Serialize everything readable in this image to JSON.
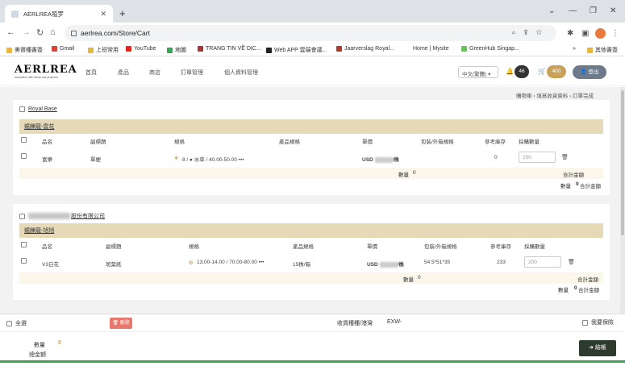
{
  "browser": {
    "tab_title": "AERLREA殖罗",
    "url": "aerlrea.com/Store/Cart",
    "bookmarks": [
      "美督種書簽",
      "Gmail",
      "上班常用",
      "YouTube",
      "地圖",
      "TRANG TIN VỀ DỊC...",
      "Web APP 雲端會議...",
      "Jaarverslag Royal...",
      "Home | Mysite",
      "GreenHub Singap...",
      "其他書簽"
    ]
  },
  "site": {
    "logo": "AERLREA",
    "logo_sub": "Innovation with ideas and products",
    "nav": [
      "首頁",
      "產品",
      "商店",
      "訂單管理",
      "個人資料管理"
    ],
    "language": "中文(繁體)",
    "notifications": "46",
    "cart_count": "400",
    "logout": "登出"
  },
  "breadcrumb": "購物車  ›  填寫收貨資料  ›  訂單完成",
  "cards": [
    {
      "supplier": "Royal Base",
      "group": "鋸鑠龍-雲花",
      "headers": [
        "品名",
        "副標題",
        "規格",
        "產品規格",
        "單價",
        "包裝/外箱規格",
        "參考庫存",
        "採購數量"
      ],
      "row": {
        "name": "富樂",
        "subtitle": "單梗",
        "spec": "8 / ● 水草 / 40.00-50.00 •••",
        "product_spec": "",
        "price_prefix": "USD",
        "price_suffix": "/株",
        "packing": "",
        "stock": "0",
        "qty_placeholder": "200"
      },
      "qty_label": "數量",
      "qty_value": "0",
      "subtotal_label": "合計金額",
      "subtotal_qty_label": "數量",
      "subtotal_qty_value": "0",
      "subtotal_total_label": "合計金額"
    },
    {
      "supplier": "股份有限公司",
      "group": "鋸鑠龍-旭旭",
      "headers": [
        "品名",
        "副標題",
        "規格",
        "產品規格",
        "單價",
        "包裝/外箱規格",
        "參考庫存",
        "採購數量"
      ],
      "row": {
        "name": "V3白花",
        "subtitle": "斑葉紙",
        "spec": "13.00-14.00 / 70.00-80.00 •••",
        "product_spec": "15株/箱",
        "price_prefix": "USD",
        "price_suffix": "/株",
        "packing": "54.5*51*35",
        "stock": "233",
        "qty_placeholder": "200"
      },
      "qty_label": "數量",
      "qty_value": "0",
      "subtotal_label": "合計金額",
      "subtotal_qty_label": "數量",
      "subtotal_qty_value": "0",
      "subtotal_total_label": "合計金額"
    }
  ],
  "bottom": {
    "select_all": "全選",
    "delete": "刪除",
    "trade_terms_label": "收貨種種/港灣",
    "trade_terms_value": "EXW-",
    "need_insurance": "我要保險",
    "qty_label": "數量",
    "qty_value": "0",
    "total_label": "總金額",
    "checkout": "結帳"
  },
  "colors": {
    "group_bar": "#e6d9b8",
    "gold": "#c9a25a",
    "checkout_bg": "#2d3a2e",
    "delete_bg": "#e8776d"
  }
}
